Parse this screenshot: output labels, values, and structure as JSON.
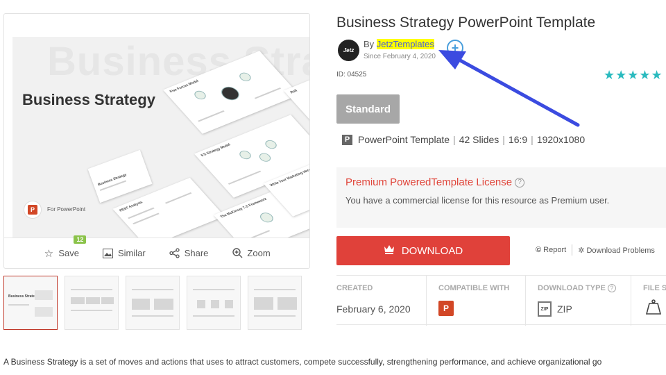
{
  "preview": {
    "ghost_title": "Business Strategy",
    "cover_title": "Business Strategy",
    "cover_badge_label": "For PowerPoint",
    "mini_slides": [
      "Five Forces Model",
      "Business Strategy",
      "5'S Strategy Model",
      "PEST Analysis",
      "The McKinsey 7-S Framework",
      "Write Your Marketing Here",
      "Roll"
    ]
  },
  "actions": {
    "save_label": "Save",
    "save_count": "12",
    "similar_label": "Similar",
    "share_label": "Share",
    "zoom_label": "Zoom"
  },
  "thumbnails": [
    {
      "label": "Business Strategy"
    },
    {
      "label": ""
    },
    {
      "label": ""
    },
    {
      "label": ""
    },
    {
      "label": ""
    }
  ],
  "product": {
    "title": "Business Strategy PowerPoint Template",
    "author_logo_text": "Jetz",
    "by_prefix": "By",
    "author": "JetzTemplates",
    "since": "Since February 4, 2020",
    "id": "ID: 04525",
    "rating_stars": "★★★★★",
    "plan_button": "Standard",
    "spec_icon": "P",
    "spec": {
      "type": "PowerPoint Template",
      "slides": "42 Slides",
      "ratio": "16:9",
      "resolution": "1920x1080"
    }
  },
  "license": {
    "title": "Premium PoweredTemplate License",
    "help_icon": "?",
    "text": "You have a commercial license for this resource as Premium user."
  },
  "download": {
    "label": "DOWNLOAD",
    "report_label": "Report",
    "problems_label": "Download Problems"
  },
  "meta": {
    "created_head": "CREATED",
    "created_value": "February 6, 2020",
    "compatible_head": "COMPATIBLE WITH",
    "compatible_icon": "P",
    "download_type_head": "DOWNLOAD TYPE",
    "download_type_value": "ZIP",
    "zip_icon_text": "ZIP",
    "file_size_head": "FILE S"
  },
  "description": "A Business Strategy is a set of moves and actions that uses to attract customers, compete successfully, strengthening performance, and achieve organizational go",
  "colors": {
    "accent_red": "#e0413a",
    "highlight_yellow": "#ffff00",
    "rating_teal": "#2bbbbf",
    "arrow_blue": "#3b4be0"
  }
}
